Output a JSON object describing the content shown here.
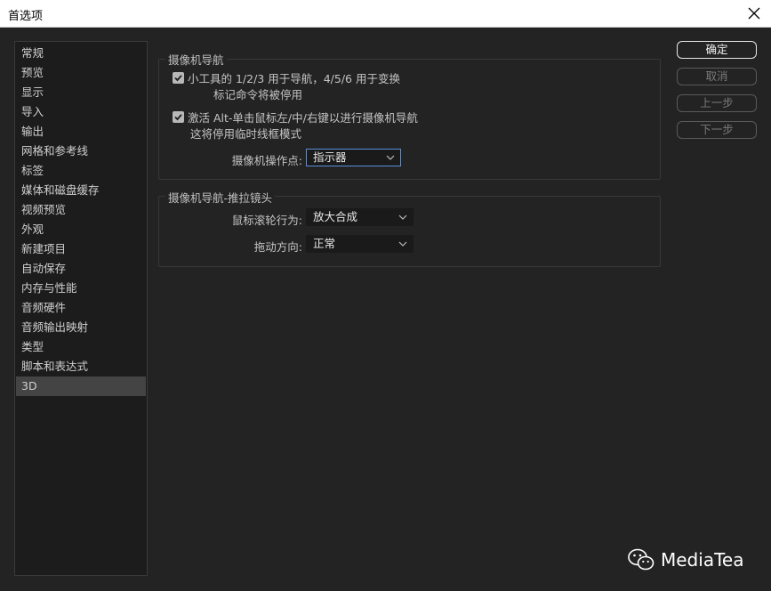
{
  "window": {
    "title": "首选项"
  },
  "sidebar": {
    "items": [
      "常规",
      "预览",
      "显示",
      "导入",
      "输出",
      "网格和参考线",
      "标签",
      "媒体和磁盘缓存",
      "视频预览",
      "外观",
      "新建项目",
      "自动保存",
      "内存与性能",
      "音频硬件",
      "音频输出映射",
      "类型",
      "脚本和表达式",
      "3D"
    ],
    "selected_index": 17
  },
  "camera_nav": {
    "title": "摄像机导航",
    "option1": {
      "checked": true,
      "line1": "小工具的 1/2/3 用于导航，4/5/6 用于变换",
      "line2": "标记命令将被停用"
    },
    "option2": {
      "checked": true,
      "line1": "激活 Alt-单击鼠标左/中/右键以进行摄像机导航",
      "line2": "这将停用临时线框模式"
    },
    "operation_point": {
      "label": "摄像机操作点:",
      "value": "指示器"
    }
  },
  "dolly": {
    "title": "摄像机导航-推拉镜头",
    "wheel": {
      "label": "鼠标滚轮行为:",
      "value": "放大合成"
    },
    "drag": {
      "label": "拖动方向:",
      "value": "正常"
    }
  },
  "buttons": {
    "ok": "确定",
    "cancel": "取消",
    "prev": "上一步",
    "next": "下一步"
  },
  "watermark": {
    "text": "MediaTea"
  }
}
